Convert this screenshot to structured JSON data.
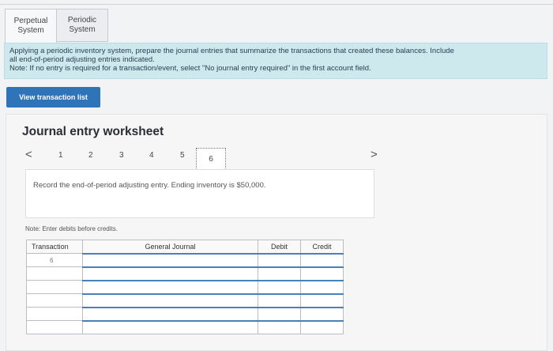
{
  "tabs": [
    {
      "label": "Perpetual System",
      "active": true
    },
    {
      "label": "Periodic System",
      "active": false
    }
  ],
  "instructions": {
    "line1": "Applying a periodic inventory system, prepare the journal entries that summarize the transactions that created these balances. Include",
    "line2": "all end-of-period adjusting entries indicated.",
    "line3": "Note: If no entry is required for a transaction/event, select \"No journal entry required\" in the first account field."
  },
  "view_button": "View transaction list",
  "worksheet": {
    "title": "Journal entry worksheet",
    "prev": "<",
    "next": ">",
    "pages": [
      "1",
      "2",
      "3",
      "4",
      "5",
      "6"
    ],
    "current_page": "6",
    "prompt": "Record the end-of-period adjusting entry. Ending inventory is $50,000.",
    "note": "Note: Enter debits before credits."
  },
  "table": {
    "headers": [
      "Transaction",
      "General Journal",
      "Debit",
      "Credit"
    ],
    "first_transaction": "6"
  }
}
